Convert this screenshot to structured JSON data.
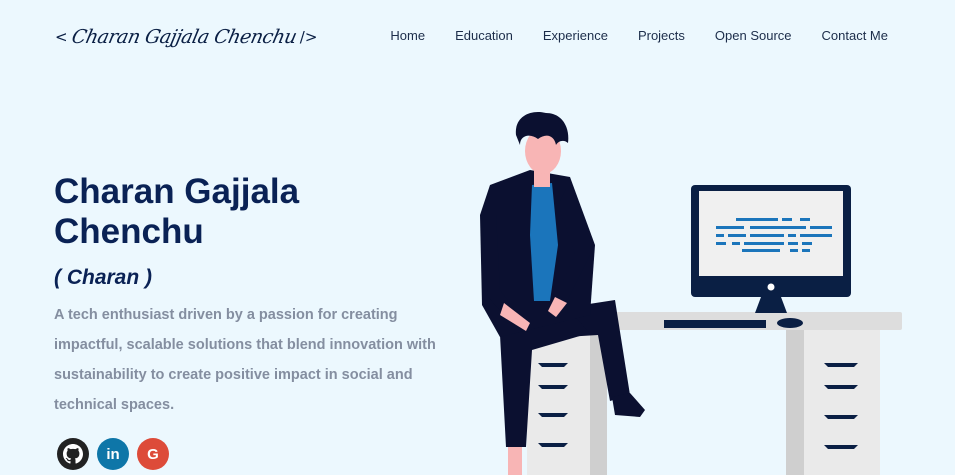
{
  "header": {
    "logo": {
      "open": "<",
      "name": "Charan Gajjala Chenchu",
      "close": "/>"
    },
    "nav": [
      {
        "label": "Home"
      },
      {
        "label": "Education"
      },
      {
        "label": "Experience"
      },
      {
        "label": "Projects"
      },
      {
        "label": "Open Source"
      },
      {
        "label": "Contact Me"
      }
    ]
  },
  "hero": {
    "name": "Charan Gajjala Chenchu",
    "nickname": "( Charan )",
    "description": "A tech enthusiast driven by a passion for creating impactful, scalable solutions that blend innovation with sustainability to create positive impact in social and technical spaces."
  },
  "socials": [
    {
      "icon": "github-icon",
      "color": "#222222"
    },
    {
      "icon": "linkedin-icon",
      "label": "in",
      "color": "#0e76a8"
    },
    {
      "icon": "google-icon",
      "label": "G",
      "color": "#dd4b39"
    }
  ],
  "colors": {
    "background": "#ecf8fe",
    "heading": "#0a2255",
    "text": "#848ea0",
    "accent": "#1b75bb"
  }
}
